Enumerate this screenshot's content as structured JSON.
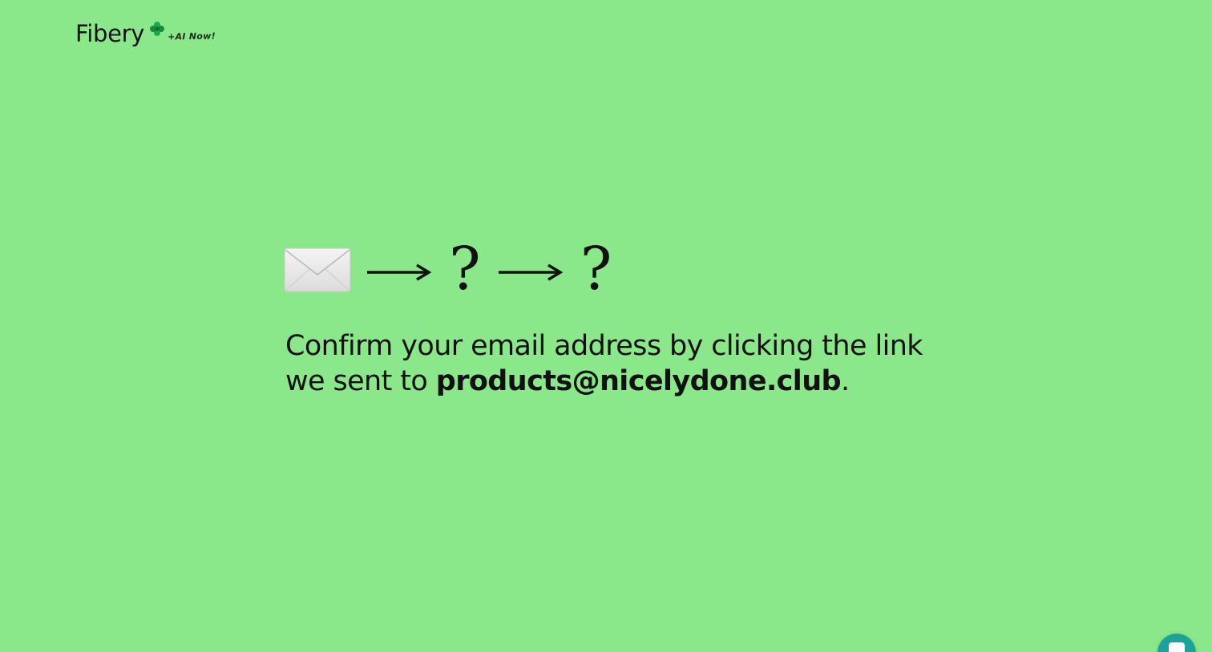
{
  "header": {
    "logo_text": "Fibery",
    "logo_icon": "clover-icon",
    "badge_text": "+AI Now!"
  },
  "flow": {
    "steps": [
      "envelope-icon",
      "arrow-right-icon",
      "?",
      "arrow-right-icon",
      "?"
    ],
    "question_1": "?",
    "question_2": "?"
  },
  "message": {
    "prefix": "Confirm your email address by clicking the link we sent to ",
    "email": "products@nicelydone.club",
    "suffix": "."
  },
  "chat": {
    "icon": "chat-bubble-icon"
  },
  "colors": {
    "background": "#8be88a",
    "text": "#111111",
    "clover": "#1fa84a",
    "chat_button": "#1aa39a"
  }
}
